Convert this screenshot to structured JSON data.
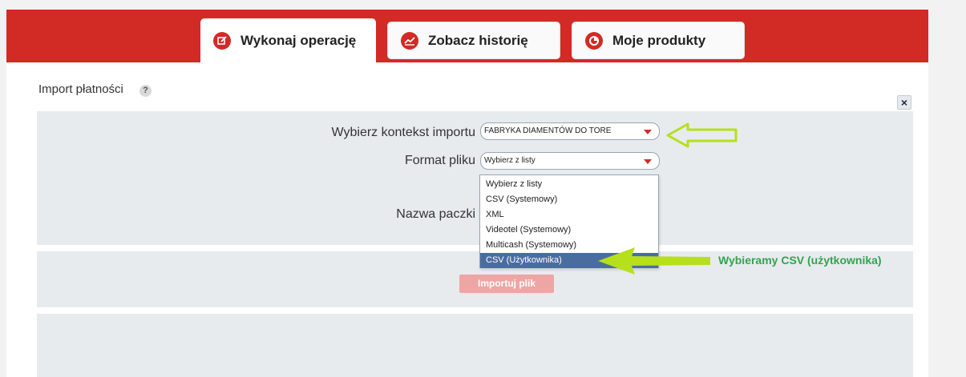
{
  "tabs": [
    {
      "label": "Wykonaj operację",
      "icon": "edit-square-icon",
      "active": true
    },
    {
      "label": "Zobacz historię",
      "icon": "line-chart-icon",
      "active": false
    },
    {
      "label": "Moje produkty",
      "icon": "pie-chart-icon",
      "active": false
    }
  ],
  "section": {
    "title": "Import płatności",
    "help": "?",
    "close": "×"
  },
  "form": {
    "context_label": "Wybierz kontekst importu",
    "context_value": "FABRYKA DIAMENTÓW DO TORE",
    "format_label": "Format pliku",
    "format_value": "Wybierz z listy",
    "package_label": "Nazwa paczki",
    "format_options": [
      "Wybierz z listy",
      "CSV (Systemowy)",
      "XML",
      "Videotel (Systemowy)",
      "Multicash (Systemowy)",
      "CSV (Użytkownika)"
    ],
    "selected_option": "CSV (Użytkownika)",
    "import_button": "Importuj plik"
  },
  "annotation": {
    "note": "Wybieramy CSV (użytkownika)",
    "arrow_color": "#b5e01b",
    "note_color": "#35a24d"
  },
  "colors": {
    "brand_red": "#d22a25",
    "panel_bg": "#e7ebee",
    "selected_option_bg": "#4a6da0"
  }
}
